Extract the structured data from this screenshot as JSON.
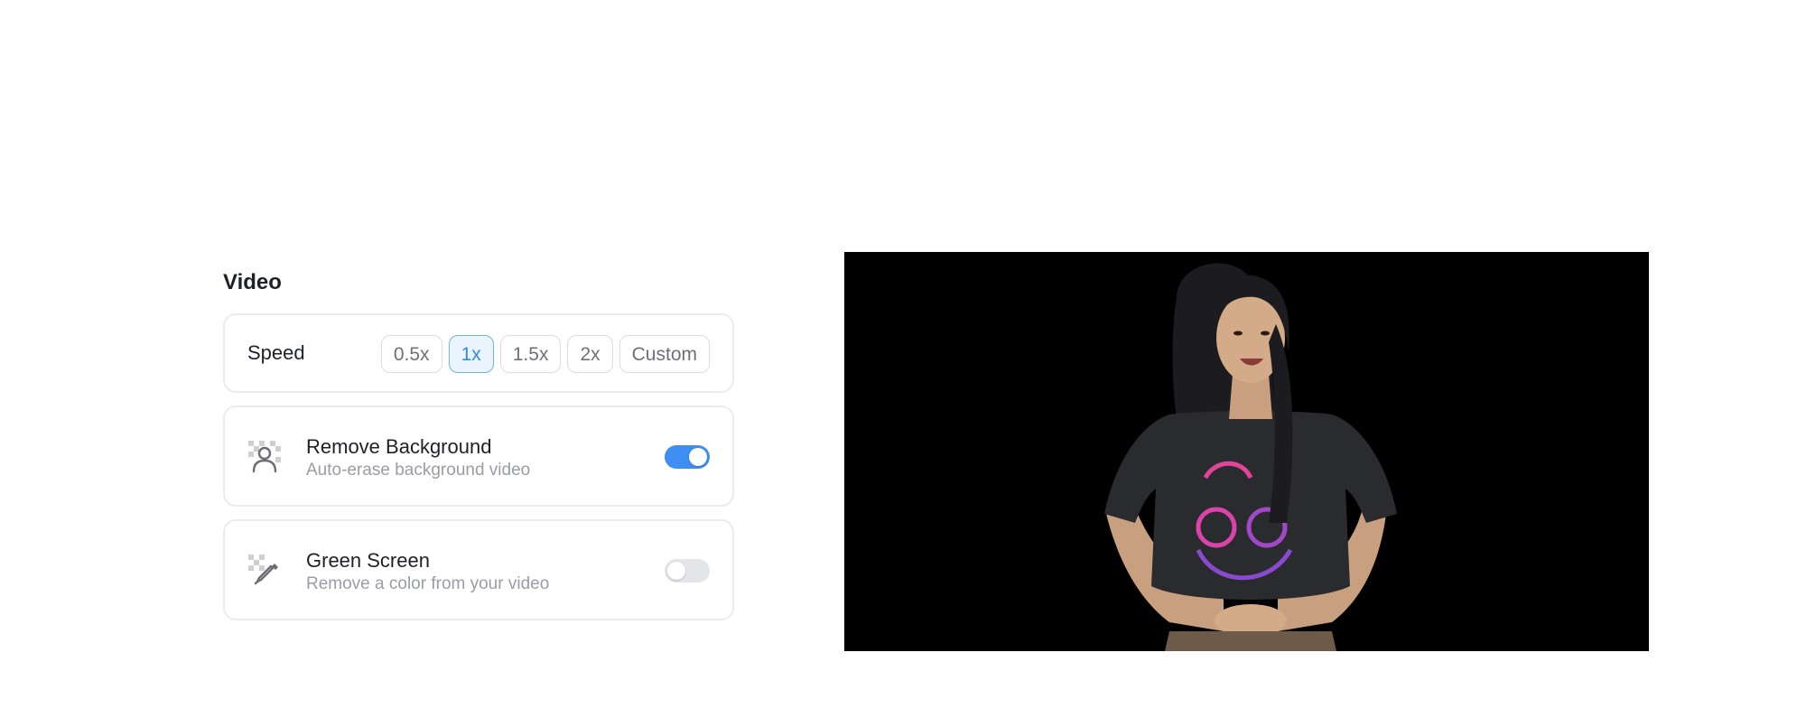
{
  "video_section": {
    "title": "Video",
    "speed": {
      "label": "Speed",
      "options": [
        "0.5x",
        "1x",
        "1.5x",
        "2x",
        "Custom"
      ],
      "selected": "1x"
    },
    "remove_background": {
      "title": "Remove Background",
      "subtitle": "Auto-erase background video",
      "enabled": true,
      "icon": "person-transparent-icon"
    },
    "green_screen": {
      "title": "Green Screen",
      "subtitle": "Remove a color from your video",
      "enabled": false,
      "icon": "eyedropper-icon"
    }
  },
  "colors": {
    "accent": "#3f8ff2",
    "selected_border": "#6fb3ea",
    "video_background": "#000000"
  }
}
